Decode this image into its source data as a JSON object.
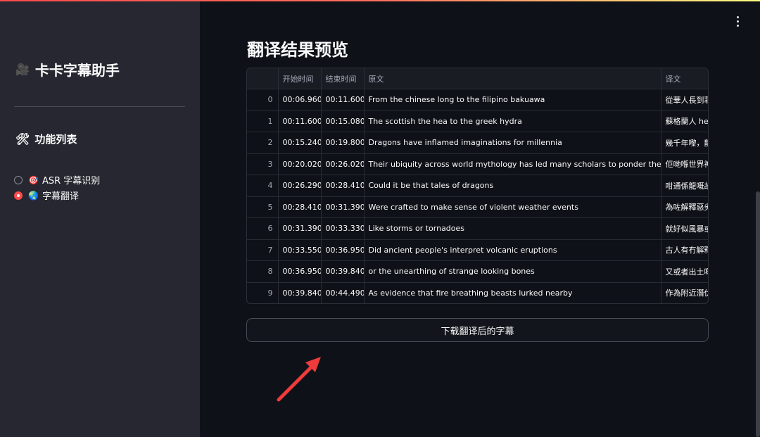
{
  "sidebar": {
    "app_title": "卡卡字幕助手",
    "title_icon": "film-projector-icon",
    "section_title": "功能列表",
    "section_icon": "hammer-wrench-icon",
    "items": [
      {
        "label": "ASR 字幕识别",
        "icon": "target-icon",
        "selected": false
      },
      {
        "label": "字幕翻译",
        "icon": "globe-icon",
        "selected": true
      }
    ]
  },
  "main": {
    "title": "翻译结果预览",
    "table": {
      "columns": [
        "",
        "开始时间",
        "结束时间",
        "原文",
        "译文"
      ],
      "rows": [
        {
          "index": "0",
          "start": "00:06.960",
          "end": "00:11.600",
          "original": "From the chinese long to the filipino bakuawa",
          "translation": "從華人長到菲"
        },
        {
          "index": "1",
          "start": "00:11.600",
          "end": "00:15.080",
          "original": "The scottish the hea to the greek hydra",
          "translation": "蘇格蘭人 hea"
        },
        {
          "index": "2",
          "start": "00:15.240",
          "end": "00:19.800",
          "original": "Dragons have inflamed imaginations for millennia",
          "translation": "幾千年嚟，龍"
        },
        {
          "index": "3",
          "start": "00:20.020",
          "end": "00:26.020",
          "original": "Their ubiquity across world mythology has led many scholars to ponder their possible",
          "translation": "佢哋喺世界神"
        },
        {
          "index": "4",
          "start": "00:26.290",
          "end": "00:28.410",
          "original": "Could it be that tales of dragons",
          "translation": "咁通係龍嘅故"
        },
        {
          "index": "5",
          "start": "00:28.410",
          "end": "00:31.390",
          "original": "Were crafted to make sense of violent weather events",
          "translation": "為咗解釋惡劣"
        },
        {
          "index": "6",
          "start": "00:31.390",
          "end": "00:33.330",
          "original": "Like storms or tornadoes",
          "translation": "就好似風暴或"
        },
        {
          "index": "7",
          "start": "00:33.550",
          "end": "00:36.950",
          "original": "Did ancient people's interpret volcanic eruptions",
          "translation": "古人有冇解釋"
        },
        {
          "index": "8",
          "start": "00:36.950",
          "end": "00:39.840",
          "original": "or the unearthing of strange looking bones",
          "translation": "又或者出土嘅"
        },
        {
          "index": "9",
          "start": "00:39.840",
          "end": "00:44.490",
          "original": "As evidence that fire breathing beasts lurked nearby",
          "translation": "作為附近潛伏"
        }
      ]
    },
    "download_label": "下载翻译后的字幕"
  },
  "colors": {
    "background": "#0e1117",
    "sidebar": "#262730",
    "accent": "#ff4b4b",
    "annotation_arrow": "#ef3b3b"
  }
}
